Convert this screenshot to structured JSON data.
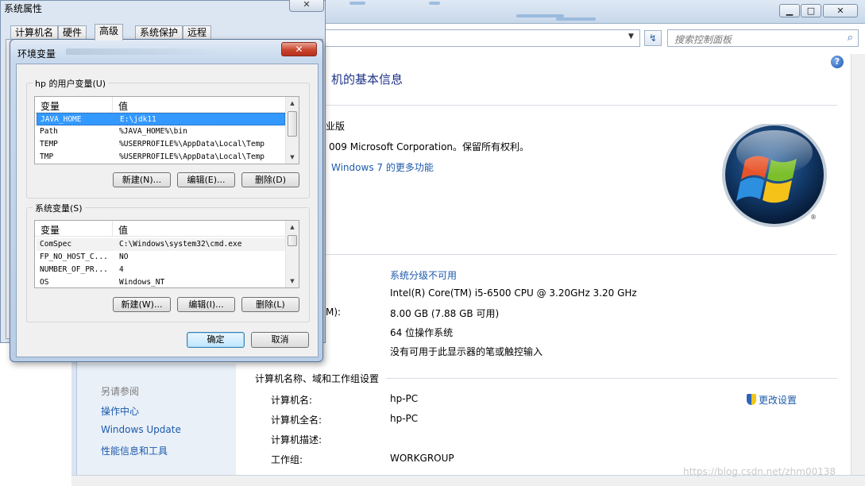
{
  "control_panel": {
    "search_placeholder": "搜索控制面板",
    "help_glyph": "?",
    "heading": "机的基本信息",
    "edition_fragment": "业版",
    "copyright": "009 Microsoft Corporation。保留所有权利。",
    "more_features": "Windows 7 的更多功能",
    "rating": "系统分级不可用",
    "processor": "Intel(R) Core(TM) i5-6500 CPU @ 3.20GHz   3.20 GHz",
    "memory_label_fragment": "M):",
    "memory": "8.00 GB (7.88 GB 可用)",
    "system_type": "64 位操作系统",
    "pen_touch": "没有可用于此显示器的笔或触控输入",
    "section_computer_name": "计算机名称、域和工作组设置",
    "computer_name_label": "计算机名:",
    "computer_name": "hp-PC",
    "full_name_label": "计算机全名:",
    "full_name": "hp-PC",
    "description_label": "计算机描述:",
    "workgroup_label": "工作组:",
    "workgroup": "WORKGROUP",
    "change_settings": "更改设置",
    "sidebar": {
      "see_also": "另请参阅",
      "items": [
        "操作中心",
        "Windows Update",
        "性能信息和工具"
      ]
    },
    "watermark": "https://blog.csdn.net/zhm00138"
  },
  "system_properties": {
    "title": "系统属性",
    "close_glyph": "✕",
    "tabs": [
      "计算机名",
      "硬件",
      "高级",
      "系统保护",
      "远程"
    ],
    "active_tab": "高级"
  },
  "env_dialog": {
    "title": "环境变量",
    "close_glyph": "✕",
    "user_group_label": "hp 的用户变量(U)",
    "system_group_label": "系统变量(S)",
    "col_variable": "变量",
    "col_value": "值",
    "user_vars": [
      {
        "name": "JAVA_HOME",
        "value": "E:\\jdk11"
      },
      {
        "name": "Path",
        "value": "%JAVA_HOME%\\bin"
      },
      {
        "name": "TEMP",
        "value": "%USERPROFILE%\\AppData\\Local\\Temp"
      },
      {
        "name": "TMP",
        "value": "%USERPROFILE%\\AppData\\Local\\Temp"
      }
    ],
    "system_vars": [
      {
        "name": "ComSpec",
        "value": "C:\\Windows\\system32\\cmd.exe"
      },
      {
        "name": "FP_NO_HOST_C...",
        "value": "NO"
      },
      {
        "name": "NUMBER_OF_PR...",
        "value": "4"
      },
      {
        "name": "OS",
        "value": "Windows_NT"
      }
    ],
    "user_buttons": {
      "new": "新建(N)...",
      "edit": "编辑(E)...",
      "delete": "删除(D)"
    },
    "system_buttons": {
      "new": "新建(W)...",
      "edit": "编辑(I)...",
      "delete": "删除(L)"
    },
    "ok": "确定",
    "cancel": "取消"
  }
}
